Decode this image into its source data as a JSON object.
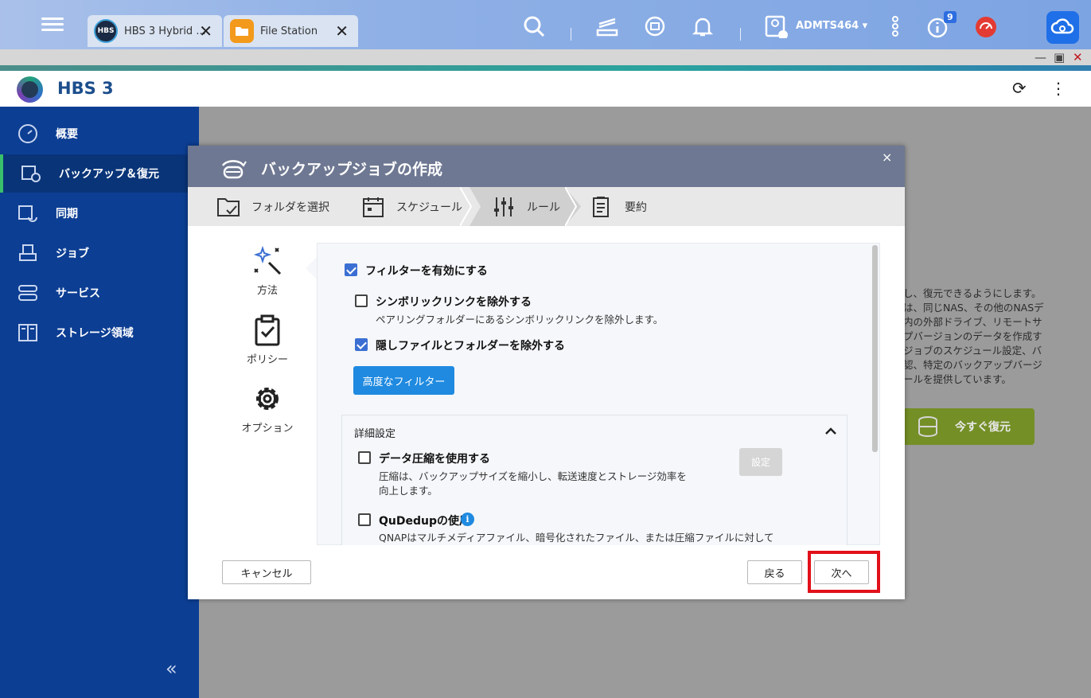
{
  "taskbar": {
    "tabs": [
      {
        "label": "HBS 3 Hybrid ...",
        "icon": "hbs-app-icon",
        "icon_text": "HBS"
      },
      {
        "label": "File Station",
        "icon": "folder-app-icon"
      }
    ],
    "user": "ADMTS464 ▾",
    "notification_count": "9"
  },
  "app": {
    "title": "HBS 3",
    "logo_text": "HBS"
  },
  "sidebar": {
    "items": [
      {
        "label": "概要",
        "icon": "dashboard-icon"
      },
      {
        "label": "バックアップ＆復元",
        "icon": "backup-restore-icon",
        "active": true
      },
      {
        "label": "同期",
        "icon": "sync-icon"
      },
      {
        "label": "ジョブ",
        "icon": "jobs-icon"
      },
      {
        "label": "サービス",
        "icon": "services-icon"
      },
      {
        "label": "ストレージ領域",
        "icon": "storage-icon"
      }
    ],
    "collapse_label": "«"
  },
  "background": {
    "lines": [
      "し、復元できるようにします。",
      "は、同じNAS、その他のNASデ",
      "内の外部ドライブ、リモートサ",
      "プバージョンのデータを作成す",
      "ジョブのスケジュール設定、バ",
      "認、特定のバックアップバージ",
      "ールを提供しています。"
    ],
    "restore_button": "今すぐ復元"
  },
  "dialog": {
    "title": "バックアップジョブの作成",
    "close": "×",
    "steps": [
      {
        "label": "フォルダを選択",
        "icon": "folder-check-icon"
      },
      {
        "label": "スケジュール",
        "icon": "calendar-icon"
      },
      {
        "label": "ルール",
        "icon": "sliders-icon",
        "active": true
      },
      {
        "label": "要約",
        "icon": "summary-icon"
      }
    ],
    "side_tabs": [
      {
        "label": "方法",
        "icon": "magic-wand-icon",
        "active": true
      },
      {
        "label": "ポリシー",
        "icon": "clipboard-check-icon"
      },
      {
        "label": "オプション",
        "icon": "gear-icon"
      }
    ],
    "filters": {
      "enable": {
        "label": "フィルターを有効にする",
        "checked": true
      },
      "symlink": {
        "label": "シンボリックリンクを除外する",
        "checked": false,
        "desc": "ペアリングフォルダーにあるシンボリックリンクを除外します。"
      },
      "hidden": {
        "label": "隠しファイルとフォルダーを除外する",
        "checked": true
      },
      "advanced_button": "高度なフィルター"
    },
    "details": {
      "title": "詳細設定",
      "compression": {
        "label": "データ圧縮を使用する",
        "checked": false,
        "desc_line1": "圧縮は、バックアップサイズを縮小し、転送速度とストレージ効率を",
        "desc_line2": "向上します。",
        "settings_button": "設定"
      },
      "qudedup": {
        "label": "QuDedupの使用",
        "checked": false,
        "desc": "QNAPはマルチメディアファイル、暗号化されたファイル、または圧縮ファイルに対して"
      }
    },
    "footer": {
      "cancel": "キャンセル",
      "back": "戻る",
      "next": "次へ"
    }
  },
  "colors": {
    "sidebar": "#0c3e93",
    "accent_blue": "#1f8ae0",
    "highlight": "#e2101a",
    "restore_green": "#748f26"
  }
}
